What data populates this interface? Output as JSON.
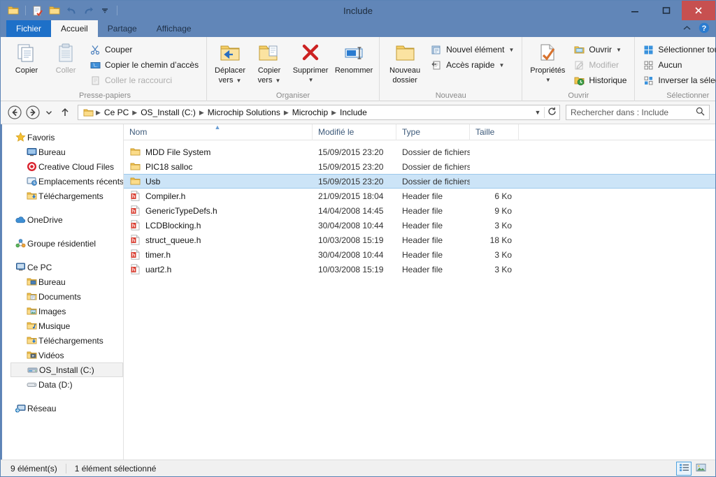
{
  "window": {
    "title": "Include",
    "colors": {
      "titlebar": "#6186b8",
      "accent": "#1e70c8",
      "close": "#c75050",
      "selection": "#cce4f7"
    },
    "controls": {
      "minimize": "minimize",
      "maximize": "maximize",
      "close": "close"
    }
  },
  "quick_access": {
    "items": [
      {
        "name": "folder-properties",
        "icon": "folder-icon"
      },
      {
        "name": "new-folder",
        "icon": "new-folder-icon"
      },
      {
        "name": "properties",
        "icon": "properties-icon"
      },
      {
        "name": "undo",
        "icon": "undo-icon"
      },
      {
        "name": "redo",
        "icon": "redo-icon"
      },
      {
        "name": "customize",
        "icon": "chevron-down-icon"
      }
    ]
  },
  "tabs": [
    {
      "label": "Fichier",
      "state": "file"
    },
    {
      "label": "Accueil",
      "state": "active"
    },
    {
      "label": "Partage",
      "state": "normal"
    },
    {
      "label": "Affichage",
      "state": "normal"
    }
  ],
  "ribbon": {
    "collapse_label": "^",
    "help_label": "?",
    "groups": [
      {
        "title": "Presse-papiers",
        "big": [
          {
            "label_line1": "Copier",
            "label_line2": "",
            "icon": "copy-icon",
            "disabled": false
          },
          {
            "label_line1": "Coller",
            "label_line2": "",
            "icon": "paste-icon",
            "disabled": true
          }
        ],
        "small": [
          {
            "label": "Couper",
            "icon": "scissors-icon",
            "disabled": false,
            "caret": false
          },
          {
            "label": "Copier le chemin d’accès",
            "icon": "copy-path-icon",
            "disabled": false,
            "caret": false
          },
          {
            "label": "Coller le raccourci",
            "icon": "paste-shortcut-icon",
            "disabled": true,
            "caret": false
          }
        ]
      },
      {
        "title": "Organiser",
        "big": [
          {
            "label_line1": "Déplacer",
            "label_line2": "vers",
            "icon": "move-to-icon",
            "caret": true
          },
          {
            "label_line1": "Copier",
            "label_line2": "vers",
            "icon": "copy-to-icon",
            "caret": true
          },
          {
            "label_line1": "Supprimer",
            "label_line2": "",
            "icon": "delete-icon",
            "caret": true
          },
          {
            "label_line1": "Renommer",
            "label_line2": "",
            "icon": "rename-icon",
            "caret": false
          }
        ],
        "small": []
      },
      {
        "title": "Nouveau",
        "big": [
          {
            "label_line1": "Nouveau",
            "label_line2": "dossier",
            "icon": "new-folder-big-icon",
            "caret": false
          }
        ],
        "small": [
          {
            "label": "Nouvel élément",
            "icon": "new-item-icon",
            "disabled": false,
            "caret": true
          },
          {
            "label": "Accès rapide",
            "icon": "quick-access-icon",
            "disabled": false,
            "caret": true
          }
        ]
      },
      {
        "title": "Ouvrir",
        "big": [
          {
            "label_line1": "Propriétés",
            "label_line2": "",
            "icon": "properties-big-icon",
            "caret": true
          }
        ],
        "small": [
          {
            "label": "Ouvrir",
            "icon": "open-icon",
            "disabled": false,
            "caret": true
          },
          {
            "label": "Modifier",
            "icon": "edit-icon",
            "disabled": true,
            "caret": false
          },
          {
            "label": "Historique",
            "icon": "history-icon",
            "disabled": false,
            "caret": false
          }
        ]
      },
      {
        "title": "Sélectionner",
        "big": [],
        "small": [
          {
            "label": "Sélectionner tout",
            "icon": "select-all-icon",
            "disabled": false,
            "caret": false
          },
          {
            "label": "Aucun",
            "icon": "select-none-icon",
            "disabled": false,
            "caret": false
          },
          {
            "label": "Inverser la sélection",
            "icon": "invert-selection-icon",
            "disabled": false,
            "caret": false
          }
        ]
      }
    ]
  },
  "addressbar": {
    "back": "back-icon",
    "forward": "forward-icon",
    "recent": "recent-locations-icon",
    "up": "up-icon",
    "breadcrumbs": [
      "Ce PC",
      "OS_Install (C:)",
      "Microchip Solutions",
      "Microchip",
      "Include"
    ],
    "dropdown": "chevron-down-icon",
    "refresh": "refresh-icon",
    "search": {
      "placeholder": "Rechercher dans : Include",
      "value": "",
      "icon": "search-icon"
    }
  },
  "navpane": {
    "sections": [
      {
        "root": {
          "label": "Favoris",
          "icon": "star-icon"
        },
        "children": [
          {
            "label": "Bureau",
            "icon": "desktop-icon"
          },
          {
            "label": "Creative Cloud Files",
            "icon": "creative-cloud-icon"
          },
          {
            "label": "Emplacements récents",
            "icon": "recent-places-icon"
          },
          {
            "label": "Téléchargements",
            "icon": "downloads-icon"
          }
        ]
      },
      {
        "root": {
          "label": "OneDrive",
          "icon": "onedrive-icon"
        },
        "children": []
      },
      {
        "root": {
          "label": "Groupe résidentiel",
          "icon": "homegroup-icon"
        },
        "children": []
      },
      {
        "root": {
          "label": "Ce PC",
          "icon": "this-pc-icon"
        },
        "children": [
          {
            "label": "Bureau",
            "icon": "desktop-folder-icon"
          },
          {
            "label": "Documents",
            "icon": "documents-icon"
          },
          {
            "label": "Images",
            "icon": "pictures-icon"
          },
          {
            "label": "Musique",
            "icon": "music-icon"
          },
          {
            "label": "Téléchargements",
            "icon": "downloads-icon"
          },
          {
            "label": "Vidéos",
            "icon": "videos-icon"
          },
          {
            "label": "OS_Install (C:)",
            "icon": "hard-drive-icon",
            "selected": true
          },
          {
            "label": "Data (D:)",
            "icon": "drive-icon"
          }
        ]
      },
      {
        "root": {
          "label": "Réseau",
          "icon": "network-icon"
        },
        "children": []
      }
    ]
  },
  "filelist": {
    "columns": [
      {
        "label": "Nom",
        "key": "name",
        "sorted": true
      },
      {
        "label": "Modifié le",
        "key": "date"
      },
      {
        "label": "Type",
        "key": "type"
      },
      {
        "label": "Taille",
        "key": "size"
      }
    ],
    "rows": [
      {
        "name": "MDD File System",
        "date": "15/09/2015 23:20",
        "type": "Dossier de fichiers",
        "size": "",
        "icon": "folder-icon",
        "selected": false
      },
      {
        "name": "PIC18 salloc",
        "date": "15/09/2015 23:20",
        "type": "Dossier de fichiers",
        "size": "",
        "icon": "folder-icon",
        "selected": false
      },
      {
        "name": "Usb",
        "date": "15/09/2015 23:20",
        "type": "Dossier de fichiers",
        "size": "",
        "icon": "folder-icon",
        "selected": true
      },
      {
        "name": "Compiler.h",
        "date": "21/09/2015 18:04",
        "type": "Header file",
        "size": "6 Ko",
        "icon": "header-file-icon",
        "selected": false
      },
      {
        "name": "GenericTypeDefs.h",
        "date": "14/04/2008 14:45",
        "type": "Header file",
        "size": "9 Ko",
        "icon": "header-file-icon",
        "selected": false
      },
      {
        "name": "LCDBlocking.h",
        "date": "30/04/2008 10:44",
        "type": "Header file",
        "size": "3 Ko",
        "icon": "header-file-icon",
        "selected": false
      },
      {
        "name": "struct_queue.h",
        "date": "10/03/2008 15:19",
        "type": "Header file",
        "size": "18 Ko",
        "icon": "header-file-icon",
        "selected": false
      },
      {
        "name": "timer.h",
        "date": "30/04/2008 10:44",
        "type": "Header file",
        "size": "3 Ko",
        "icon": "header-file-icon",
        "selected": false
      },
      {
        "name": "uart2.h",
        "date": "10/03/2008 15:19",
        "type": "Header file",
        "size": "3 Ko",
        "icon": "header-file-icon",
        "selected": false
      }
    ]
  },
  "statusbar": {
    "item_count": "9 élément(s)",
    "selection": "1 élément sélectionné",
    "views": [
      {
        "name": "details-view",
        "icon": "details-view-icon",
        "active": true
      },
      {
        "name": "large-icons-view",
        "icon": "large-icons-view-icon",
        "active": false
      }
    ]
  }
}
